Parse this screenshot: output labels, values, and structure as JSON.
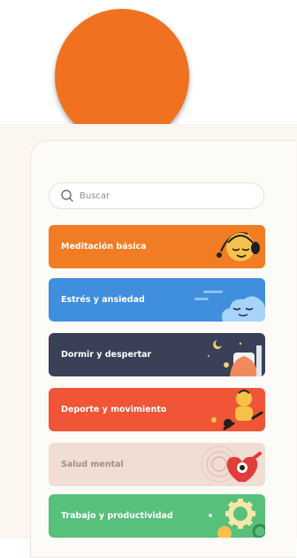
{
  "search": {
    "placeholder": "Buscar"
  },
  "categories": [
    {
      "label": "Meditación básica",
      "color": "#f27c23"
    },
    {
      "label": "Estrés y ansiedad",
      "color": "#3f8fde"
    },
    {
      "label": "Dormir y despertar",
      "color": "#3a4057"
    },
    {
      "label": "Deporte y movimiento",
      "color": "#ef5536"
    },
    {
      "label": "Salud mental",
      "color": "#f0ddd3"
    },
    {
      "label": "Trabajo y productividad",
      "color": "#57c07a"
    }
  ],
  "colors": {
    "brand": "#f07120",
    "background": "#fbf7f0"
  }
}
